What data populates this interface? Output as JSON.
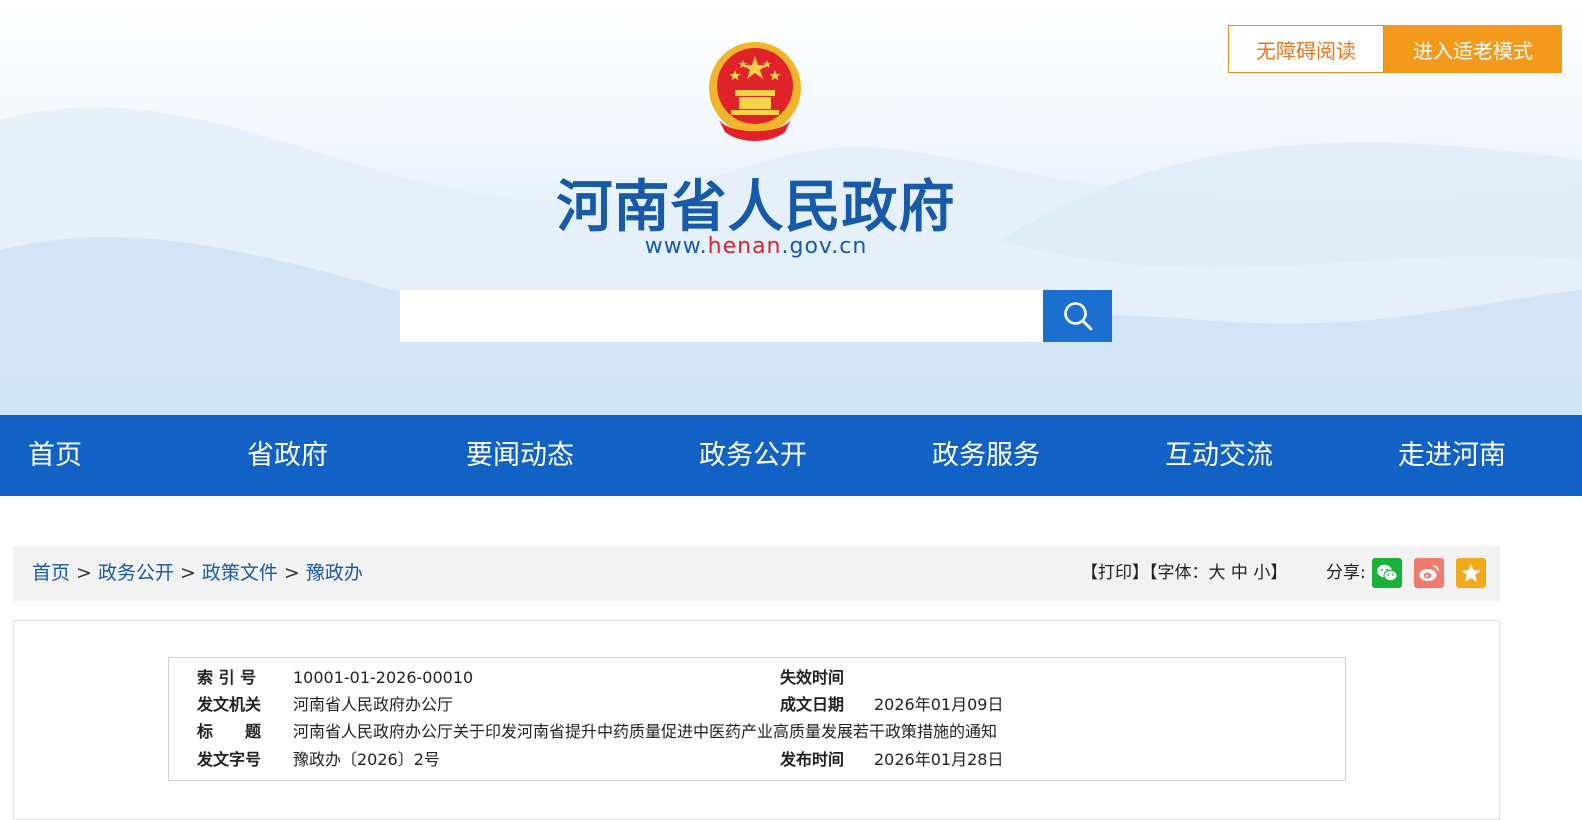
{
  "header": {
    "accessibility_label": "无障碍阅读",
    "elder_mode_label": "进入适老模式",
    "site_name": "河南省人民政府",
    "url_prefix": "www.",
    "url_highlight": "henan",
    "url_suffix": ".gov.cn",
    "search_placeholder": ""
  },
  "nav": {
    "items": [
      "首页",
      "省政府",
      "要闻动态",
      "政务公开",
      "政务服务",
      "互动交流",
      "走进河南"
    ]
  },
  "breadcrumb": {
    "items": [
      "首页",
      "政务公开",
      "政策文件",
      "豫政办"
    ],
    "separator": ">"
  },
  "tools": {
    "print": "【打印】",
    "font_prefix": "【字体：",
    "font_large": "大",
    "font_medium": "中",
    "font_small": "小",
    "font_suffix": "】",
    "share_label": "分享:"
  },
  "meta": {
    "index_label": "索 引 号",
    "index_value": "10001-01-2026-00010",
    "expire_label": "失效时间",
    "expire_value": "",
    "issuer_label": "发文机关",
    "issuer_value": "河南省人民政府办公厅",
    "created_label": "成文日期",
    "created_value": "2026年01月09日",
    "title_label": "标　　题",
    "title_value": "河南省人民政府办公厅关于印发河南省提升中药质量促进中医药产业高质量发展若干政策措施的通知",
    "docno_label": "发文字号",
    "docno_value": "豫政办〔2026〕2号",
    "published_label": "发布时间",
    "published_value": "2026年01月28日"
  },
  "colors": {
    "brand_blue": "#1162c4",
    "title_blue": "#175aa8",
    "accent_orange": "#f39a1d",
    "url_red": "#d8232a"
  }
}
